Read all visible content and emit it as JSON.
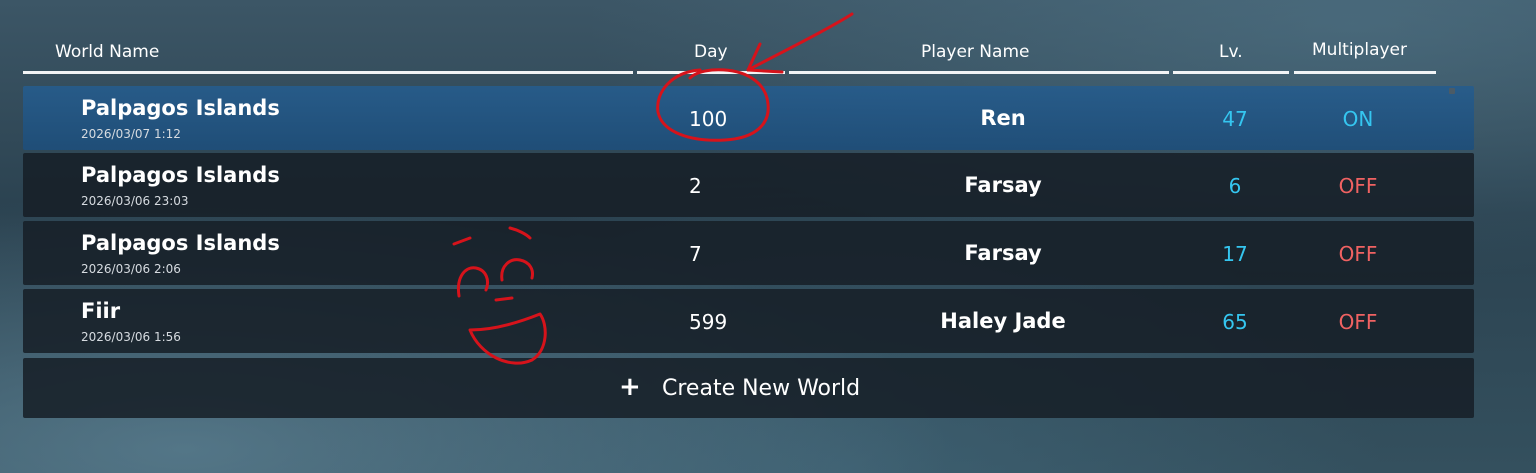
{
  "header": {
    "world_name": "World Name",
    "day": "Day",
    "player_name": "Player Name",
    "level": "Lv.",
    "multiplayer": "Multiplayer"
  },
  "worlds": [
    {
      "name": "Palpagos Islands",
      "date": "2026/03/07  1:12",
      "day": "100",
      "player": "Ren",
      "level": "47",
      "multiplayer": "ON",
      "selected": true
    },
    {
      "name": "Palpagos Islands",
      "date": "2026/03/06  23:03",
      "day": "2",
      "player": "Farsay",
      "level": "6",
      "multiplayer": "OFF",
      "selected": false
    },
    {
      "name": "Palpagos Islands",
      "date": "2026/03/06  2:06",
      "day": "7",
      "player": "Farsay",
      "level": "17",
      "multiplayer": "OFF",
      "selected": false
    },
    {
      "name": "Fiir",
      "date": "2026/03/06  1:56",
      "day": "599",
      "player": "Haley Jade",
      "level": "65",
      "multiplayer": "OFF",
      "selected": false
    }
  ],
  "create_world": {
    "icon": "plus-icon",
    "label": "Create New World"
  },
  "colors": {
    "level": "#35c6f0",
    "on": "#35c6f0",
    "off": "#f06262",
    "annotation": "#d6131b",
    "selected_row": "#265c8c"
  }
}
